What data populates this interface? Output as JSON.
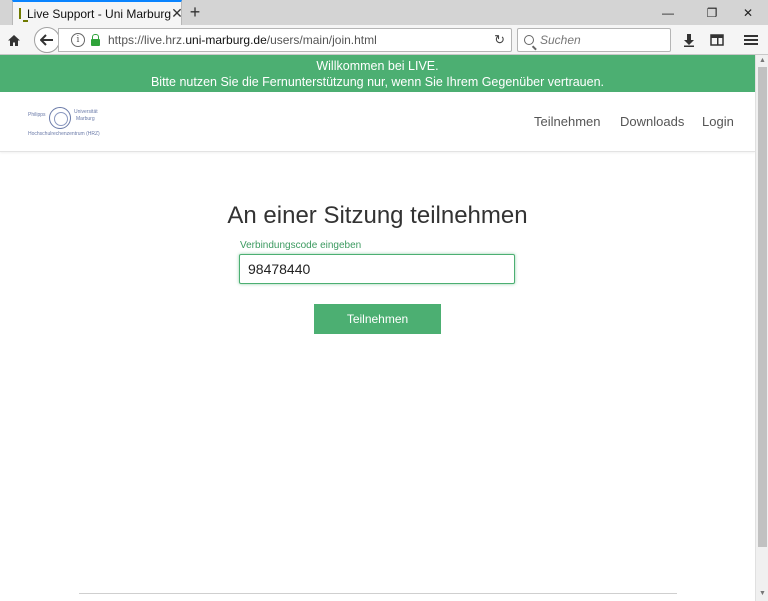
{
  "browser": {
    "tab_title": "Live Support - Uni Marburg",
    "url_prefix": "https://live.hrz.",
    "url_domain": "uni-marburg.de",
    "url_path": "/users/main/join.html",
    "search_placeholder": "Suchen"
  },
  "banner": {
    "line1": "Willkommen bei LIVE.",
    "line2": "Bitte nutzen Sie die Fernunterstützung nur, wenn Sie Ihrem Gegenüber vertrauen."
  },
  "header": {
    "logo": {
      "philipps": "Philipps",
      "universitaet": "Universität",
      "marburg": "Marburg",
      "hrz": "Hochschulrechenzentrum (HRZ)"
    },
    "menu": [
      "Teilnehmen",
      "Downloads",
      "Login"
    ]
  },
  "main": {
    "title": "An einer Sitzung teilnehmen",
    "code_label": "Verbindungscode eingeben",
    "code_value": "98478440",
    "join_button": "Teilnehmen"
  },
  "colors": {
    "accent": "#4caf72",
    "tab_highlight": "#0a84ff"
  }
}
